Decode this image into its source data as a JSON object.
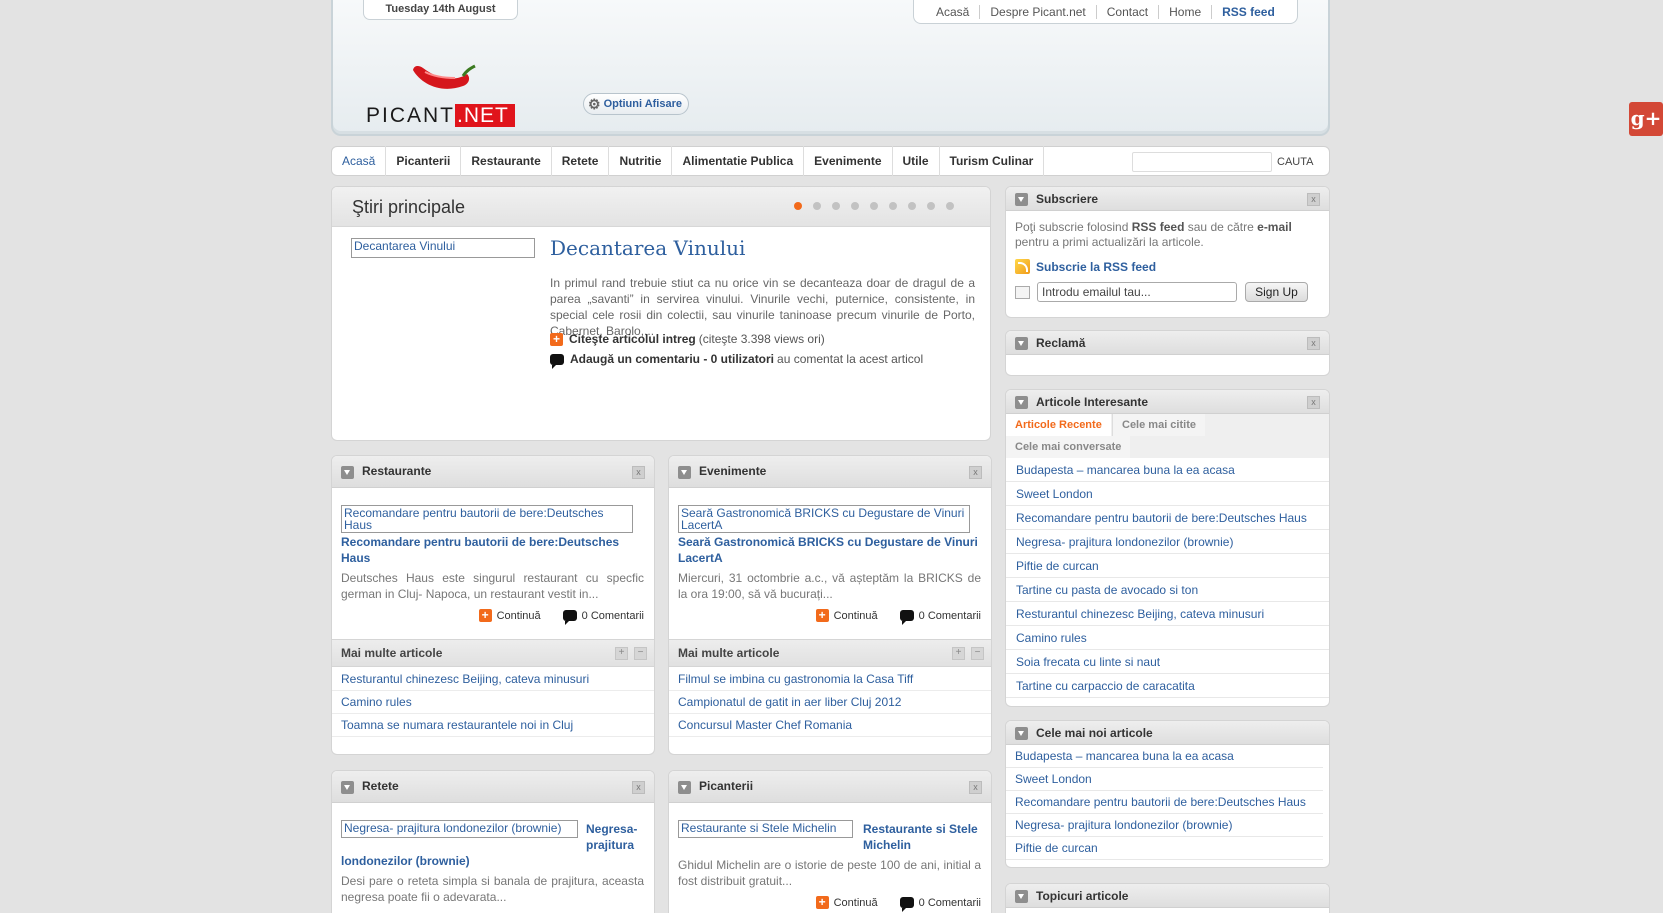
{
  "header": {
    "date": "Tuesday 14th August",
    "topnav": [
      "Acasă",
      "Despre Picant.net",
      "Contact",
      "Home",
      "RSS feed"
    ],
    "logo_text": "PICANT",
    "logo_suffix": ".NET",
    "options_label": "Optiuni Afisare"
  },
  "mainnav": {
    "items": [
      "Acasă",
      "Picanterii",
      "Restaurante",
      "Retete",
      "Nutritie",
      "Alimentatie Publica",
      "Evenimente",
      "Utile",
      "Turism Culinar"
    ],
    "search_button": "CAUTA"
  },
  "featured": {
    "heading": "Ştiri principale",
    "slide_count": 9,
    "active_slide": 1,
    "image_alt": "Decantarea Vinului",
    "title": "Decantarea Vinului",
    "excerpt": "In primul rand trebuie stiut ca nu orice vin se decanteaza doar de dragul de a parea „savanti” in servirea vinului.  Vinurile vechi, puternice, consistente,  in special cele rosii din colectii, sau vinurile taninoase precum vinurile de Porto, Cabernet, Barolo,...",
    "read_label": "Citeşte articolul intreg",
    "read_stats": "(citeşte 3.398 views ori)",
    "comment_label": "Adaugă un comentariu - 0 utilizatori",
    "comment_suffix": "au comentat la acest articol"
  },
  "boxes": {
    "restaurante": {
      "title": "Restaurante",
      "image_alt": "Recomandare pentru bautorii de bere:Deutsches Haus",
      "article_title": "Recomandare pentru bautorii de bere:Deutsches Haus",
      "excerpt": "Deutsches Haus este singurul restaurant cu specfic german in Cluj- Napoca, un restaurant vestit in...",
      "continue": "Continuă",
      "comments": "0 Comentarii",
      "more_title": "Mai multe articole",
      "more": [
        "Resturantul chinezesc Beijing, cateva minusuri",
        "Camino rules",
        "Toamna se numara restaurantele noi in Cluj"
      ]
    },
    "evenimente": {
      "title": "Evenimente",
      "image_alt": "Seară Gastronomică BRICKS cu Degustare de Vinuri LacertA",
      "article_title": "Seară Gastronomică BRICKS cu Degustare de Vinuri LacertA",
      "excerpt": "Miercuri, 31 octombrie a.c., vă așteptăm la BRICKS de la ora 19:00, să vă bucurați...",
      "continue": "Continuă",
      "comments": "0 Comentarii",
      "more_title": "Mai multe articole",
      "more": [
        "Filmul se imbina cu gastronomia la Casa Tiff",
        "Campionatul de gatit in aer liber Cluj 2012",
        "Concursul Master Chef Romania"
      ]
    },
    "retete": {
      "title": "Retete",
      "image_alt": "Negresa- prajitura londonezilor (brownie)",
      "article_title_a": "Negresa-",
      "article_title_b": "prajitura",
      "article_title_c": "londonezilor (brownie)",
      "excerpt": "Desi pare o reteta simpla si banala de prajitura, aceasta negresa poate fii o adevarata..."
    },
    "picanterii": {
      "title": "Picanterii",
      "image_alt": "Restaurante si Stele Michelin",
      "article_title_a": "Restaurante si Stele",
      "article_title_b": "Michelin",
      "excerpt": "Ghidul Michelin are  o istorie de peste 100 de ani, initial a fost distribuit gratuit...",
      "continue": "Continuă",
      "comments": "0 Comentarii"
    }
  },
  "sidebar": {
    "subscriere": {
      "title": "Subscriere",
      "text_a": "Poţi subscrie folosind ",
      "text_b": "RSS feed",
      "text_c": " sau de către ",
      "text_d": "e-mail",
      "text_e": " pentru a primi actualizări la articole.",
      "rss_link": "Subscrie la RSS feed",
      "email_placeholder": "Introdu emailul tau...",
      "signup": "Sign Up"
    },
    "reclama": {
      "title": "Reclamă"
    },
    "interesante": {
      "title": "Articole Interesante",
      "tabs": [
        "Articole Recente",
        "Cele mai citite",
        "Cele mai conversate"
      ],
      "items": [
        "Budapesta – mancarea buna la ea acasa",
        "Sweet London",
        "Recomandare pentru bautorii de bere:Deutsches Haus",
        "Negresa- prajitura londonezilor (brownie)",
        "Piftie de curcan",
        "Tartine cu pasta de avocado si ton",
        "Resturantul chinezesc Beijing, cateva minusuri",
        "Camino rules",
        "Soia frecata cu linte si naut",
        "Tartine cu carpaccio de caracatita"
      ]
    },
    "noi": {
      "title": "Cele mai noi articole",
      "items": [
        "Budapesta – mancarea buna la ea acasa",
        "Sweet London",
        "Recomandare pentru bautorii de bere:Deutsches Haus",
        "Negresa- prajitura londonezilor (brownie)",
        "Piftie de curcan"
      ]
    },
    "topicuri": {
      "title": "Topicuri articole"
    }
  },
  "colors": {
    "accent": "#f26a1b",
    "link": "#2e5f9e",
    "logo_red": "#e0141b",
    "gplus": "#d34836"
  },
  "icons": [
    "gear-icon",
    "plus-icon",
    "comment-icon",
    "collapse-icon",
    "close-icon",
    "rss-icon",
    "mail-icon",
    "google-plus-icon"
  ]
}
